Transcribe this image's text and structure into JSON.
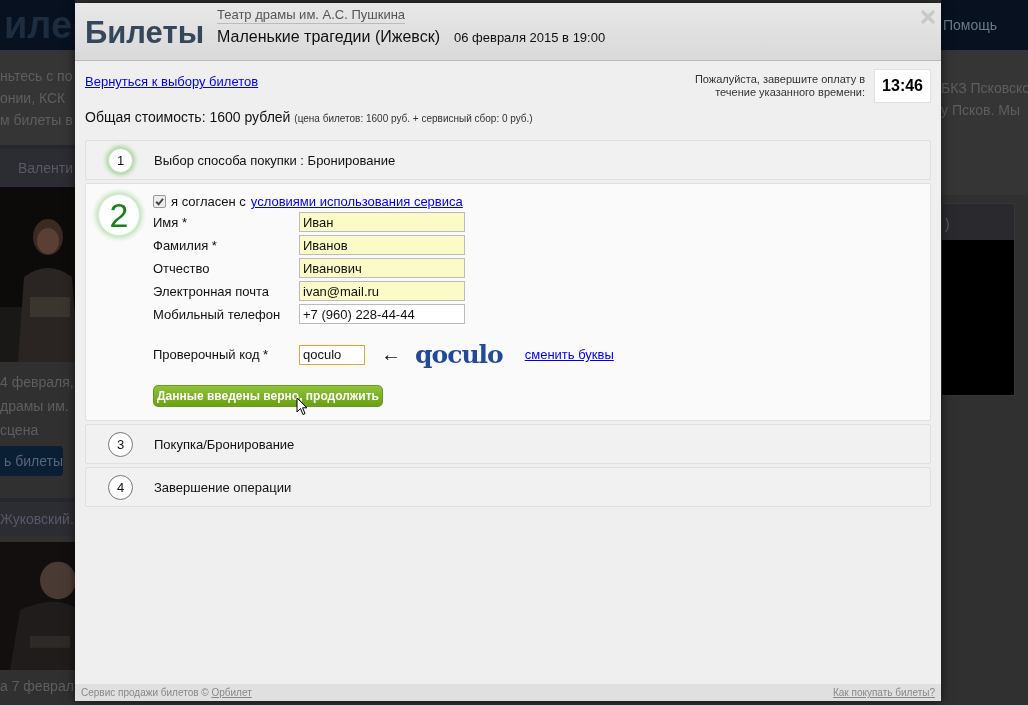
{
  "backdrop_left": {
    "logo": "иле",
    "text_lines": [
      "ньтесь с по",
      "онии, КСК",
      "м билеты в"
    ],
    "tab": "Валенти",
    "event_date": "4 февраля,",
    "event_venue": "драмы им.",
    "event_hall": "сцена",
    "event_button": "ь билеты",
    "tab_2": "Жуковский.",
    "event_date_2": "а 7 феврал"
  },
  "backdrop_right": {
    "nav_item": "Помощь",
    "text_lines": [
      "БКЗ Псковско",
      "у Псков. Мы"
    ],
    "tab": ")"
  },
  "modal": {
    "title": "Билеты",
    "venue": "Театр драмы им. А.С. Пушкина",
    "show": "Маленькие трагедии (Ижевск)",
    "date": "06 февраля 2015 в 19:00",
    "back_link": "Вернуться к выбору билетов",
    "timer_note": "Пожалуйста, завершите оплату в течение указанного времени:",
    "timer": "13:46",
    "total": "Общая стоимость: 1600 рублей",
    "total_detail": "(цена билетов: 1600 руб. + сервисный сбор: 0 руб.)",
    "steps": [
      {
        "number": "1",
        "title": "Выбор способа покупки : Бронирование",
        "expanded": false,
        "highlighted": true
      },
      {
        "number": "2",
        "expanded": true,
        "highlighted": true
      },
      {
        "number": "3",
        "title": "Покупка/Бронирование",
        "expanded": false,
        "highlighted": false
      },
      {
        "number": "4",
        "title": "Завершение операции",
        "expanded": false,
        "highlighted": false
      }
    ],
    "form": {
      "agree": {
        "checked": true,
        "text": "я согласен с",
        "link": "условиями использования сервиса"
      },
      "fields": [
        {
          "label": "Имя *",
          "value": "Иван",
          "autofilled": true
        },
        {
          "label": "Фамилия *",
          "value": "Иванов",
          "autofilled": true
        },
        {
          "label": "Отчество",
          "value": "Иванович",
          "autofilled": true
        },
        {
          "label": "Электронная почта",
          "value": "ivan@mail.ru",
          "autofilled": true
        },
        {
          "label": "Мобильный телефон",
          "value": "+7 (960) 228-44-44",
          "autofilled": false
        }
      ],
      "captcha": {
        "label": "Проверочный код *",
        "value": "qoculo",
        "focused": true,
        "arrow": "←",
        "image_text": "qoculo",
        "change_link": "сменить буквы"
      },
      "submit": "Данные введены верно, продолжить"
    },
    "footer": {
      "text": "Сервис продажи билетов ©",
      "link": "Орбилет",
      "help_link": "Как покупать билеты?"
    }
  }
}
